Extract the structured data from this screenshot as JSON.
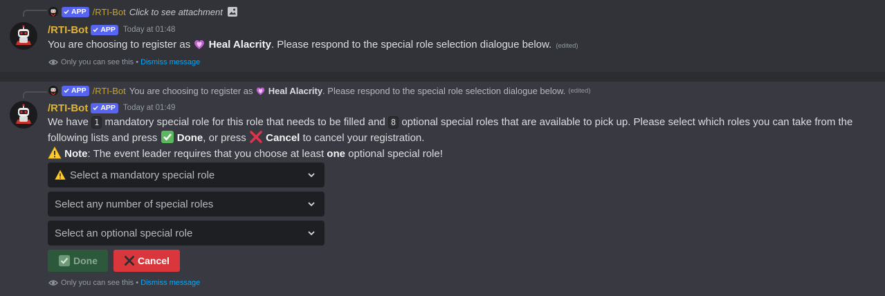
{
  "msg1": {
    "reply": {
      "app_tag": "APP",
      "name": "/RTI-Bot",
      "text": "Click to see attachment",
      "attachment_icon": "image-icon"
    },
    "author": "/RTI-Bot",
    "app_tag": "APP",
    "timestamp": "Today at 01:48",
    "text_before": "You are choosing to register as",
    "role_name": "Heal Alacrity",
    "text_after": ". Please respond to the special role selection dialogue below.",
    "edited": "(edited)",
    "ephemeral_text": "Only you can see this",
    "separator": "•",
    "dismiss": "Dismiss message"
  },
  "msg2": {
    "reply": {
      "app_tag": "APP",
      "name": "/RTI-Bot",
      "text_before": "You are choosing to register as",
      "role_name": "Heal Alacrity",
      "text_after": ". Please respond to the special role selection dialogue below.",
      "edited": "(edited)"
    },
    "author": "/RTI-Bot",
    "app_tag": "APP",
    "timestamp": "Today at 01:49",
    "line1_a": "We have",
    "mandatory_count": "1",
    "line1_b": "mandatory special role for this role that needs to be filled and",
    "optional_count": "8",
    "line1_c": "optional special roles that are available to pick up. Please select which roles you can take from the",
    "line2_a": "following lists and press",
    "done_word": "Done",
    "line2_b": ", or press",
    "cancel_word": "Cancel",
    "line2_c": "to cancel your registration.",
    "note_label": "Note",
    "note_a": ": The event leader requires that you choose at least",
    "note_one": "one",
    "note_b": "optional special role!",
    "selects": [
      {
        "placeholder": "Select a mandatory special role",
        "icon": "warning-icon"
      },
      {
        "placeholder": "Select any number of special roles"
      },
      {
        "placeholder": "Select an optional special role"
      }
    ],
    "buttons": {
      "done": "Done",
      "cancel": "Cancel"
    },
    "ephemeral_text": "Only you can see this",
    "separator": "•",
    "dismiss": "Dismiss message"
  },
  "colors": {
    "bot_name": "#e0b33a",
    "app_tag": "#5865f2",
    "link": "#00a8fc",
    "cancel_button": "#da373c",
    "done_button": "#2c583b"
  }
}
